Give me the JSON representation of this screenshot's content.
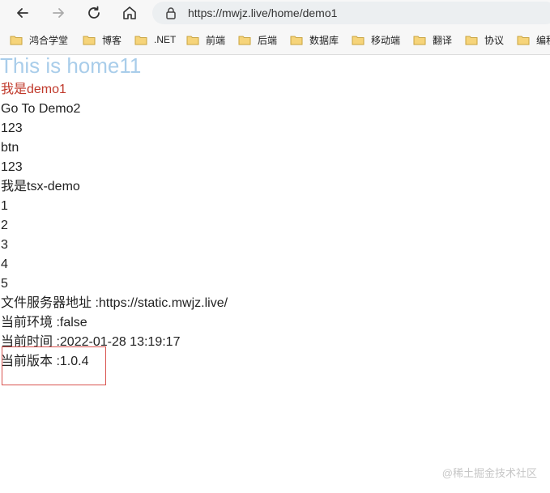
{
  "browser": {
    "url": "https://mwjz.live/home/demo1",
    "bookmarks": [
      {
        "label": "鸿合学堂"
      },
      {
        "label": "博客"
      },
      {
        "label": ".NET"
      },
      {
        "label": "前端"
      },
      {
        "label": "后端"
      },
      {
        "label": "数据库"
      },
      {
        "label": "移动端"
      },
      {
        "label": "翻译"
      },
      {
        "label": "协议"
      },
      {
        "label": "编程"
      }
    ]
  },
  "page": {
    "title": "This is home11",
    "lines": [
      "我是demo1",
      "Go To Demo2",
      "123",
      "btn",
      "123",
      "我是tsx-demo",
      "1",
      "2",
      "3",
      "4",
      "5",
      "文件服务器地址 :https://static.mwjz.live/",
      "当前环境 :false",
      "当前时间 :2022-01-28 13:19:17",
      "当前版本 :1.0.4"
    ]
  },
  "watermark": "@稀土掘金技术社区",
  "colors": {
    "title": "#a9cdea",
    "highlight_text": "#c0392b",
    "annotation_box": "#d9534f"
  }
}
